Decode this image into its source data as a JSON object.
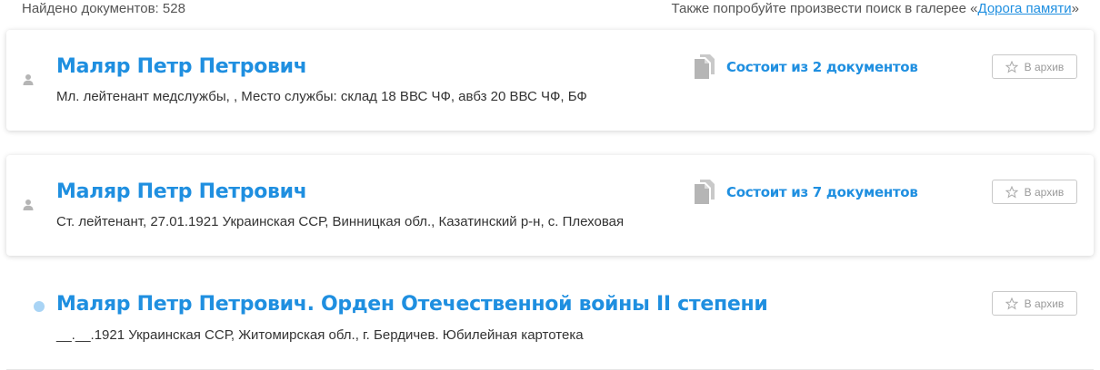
{
  "header": {
    "found_label": "Найдено документов: 528",
    "gallery_prefix": "Также попробуйте произвести поиск в галерее «",
    "gallery_link": "Дорога памяти",
    "gallery_suffix": "»"
  },
  "results": [
    {
      "name": "Маляр Петр Петрович",
      "description": "Мл. лейтенант медслужбы, , Место службы: склад 18 ВВС ЧФ, авбз 20 ВВС ЧФ, БФ",
      "docs_label": "Состоит из 2 документов",
      "archive_label": "В архив",
      "icon": "person-icon"
    },
    {
      "name": "Маляр Петр Петрович",
      "description": "Ст. лейтенант, 27.01.1921 Украинская ССР, Винницкая обл., Казатинский р-н, с. Плеховая",
      "docs_label": "Состоит из 7 документов",
      "archive_label": "В архив",
      "icon": "person-icon"
    },
    {
      "name": "Маляр Петр Петрович. Орден Отечественной войны II степени",
      "description": "__.__.1921 Украинская ССР, Житомирская обл., г. Бердичев. Юбилейная картотека",
      "archive_label": "В архив",
      "icon": "dot-icon"
    }
  ],
  "colors": {
    "link": "#1f8fe0",
    "dot": "#a9d4f5",
    "icon_gray": "#b5b5b5"
  }
}
